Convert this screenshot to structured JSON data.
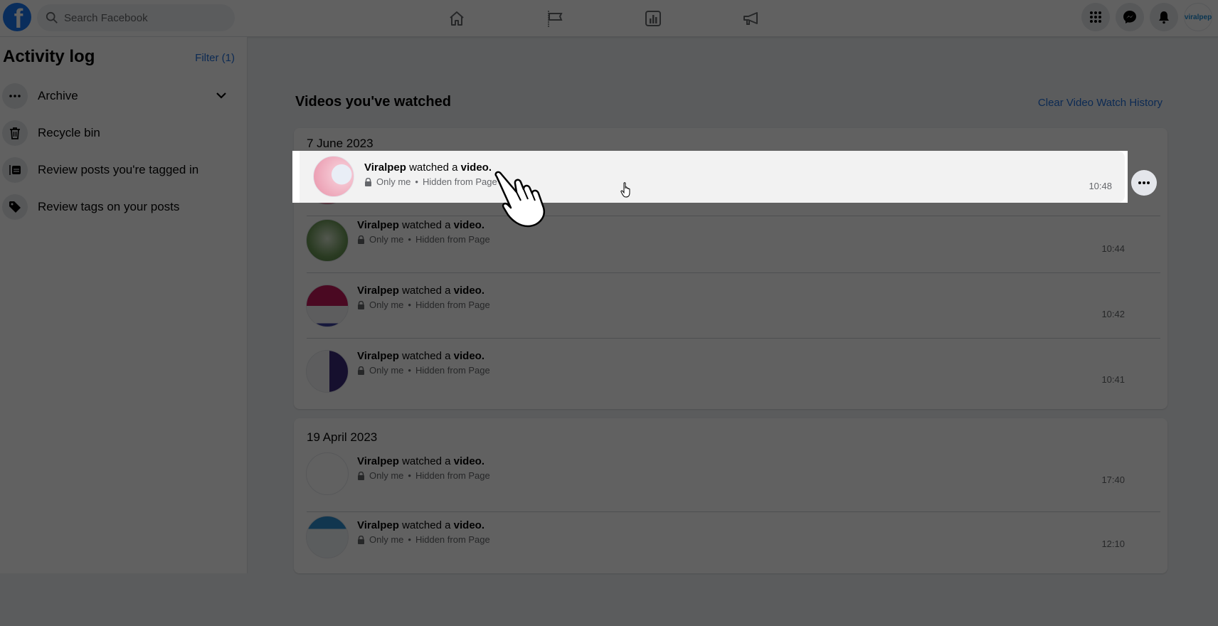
{
  "topbar": {
    "logo": "facebook-logo",
    "logo_glyph": "f",
    "search_placeholder": "Search Facebook",
    "nav_icons": [
      "home-icon",
      "flag-icon",
      "insights-icon",
      "megaphone-icon"
    ],
    "right_icons": [
      "menu-grid-icon",
      "messenger-icon",
      "bell-icon"
    ],
    "profile_label": "viralpep"
  },
  "sidebar": {
    "title": "Activity log",
    "filter_label": "Filter (1)",
    "items": [
      {
        "label": "Archive",
        "icon": "more-dots-icon",
        "expandable": true
      },
      {
        "label": "Recycle bin",
        "icon": "trash-icon"
      },
      {
        "label": "Review posts you're tagged in",
        "icon": "tagged-posts-icon"
      },
      {
        "label": "Review tags on your posts",
        "icon": "tag-icon"
      }
    ]
  },
  "main": {
    "title": "Videos you've watched",
    "clear_label": "Clear Video Watch History",
    "groups": [
      {
        "date": "7 June 2023",
        "entries": [
          {
            "actor": "Viralpep",
            "verb": " watched a ",
            "object": "video.",
            "privacy": "Only me",
            "status": "Hidden from Page",
            "time": "10:48",
            "highlighted": true
          },
          {
            "actor": "Viralpep",
            "verb": " watched a ",
            "object": "video.",
            "privacy": "Only me",
            "status": "Hidden from Page",
            "time": "10:44"
          },
          {
            "actor": "Viralpep",
            "verb": " watched a ",
            "object": "video.",
            "privacy": "Only me",
            "status": "Hidden from Page",
            "time": "10:42"
          },
          {
            "actor": "Viralpep",
            "verb": " watched a ",
            "object": "video.",
            "privacy": "Only me",
            "status": "Hidden from Page",
            "time": "10:41"
          }
        ]
      },
      {
        "date": "19 April 2023",
        "entries": [
          {
            "actor": "Viralpep",
            "verb": " watched a ",
            "object": "video.",
            "privacy": "Only me",
            "status": "Hidden from Page",
            "time": "17:40"
          },
          {
            "actor": "Viralpep",
            "verb": " watched a ",
            "object": "video.",
            "privacy": "Only me",
            "status": "Hidden from Page",
            "time": "12:10"
          }
        ]
      }
    ],
    "separator": "•"
  },
  "colors": {
    "brand": "#1877f2",
    "link": "#216fdb",
    "overlay": "#000000"
  }
}
